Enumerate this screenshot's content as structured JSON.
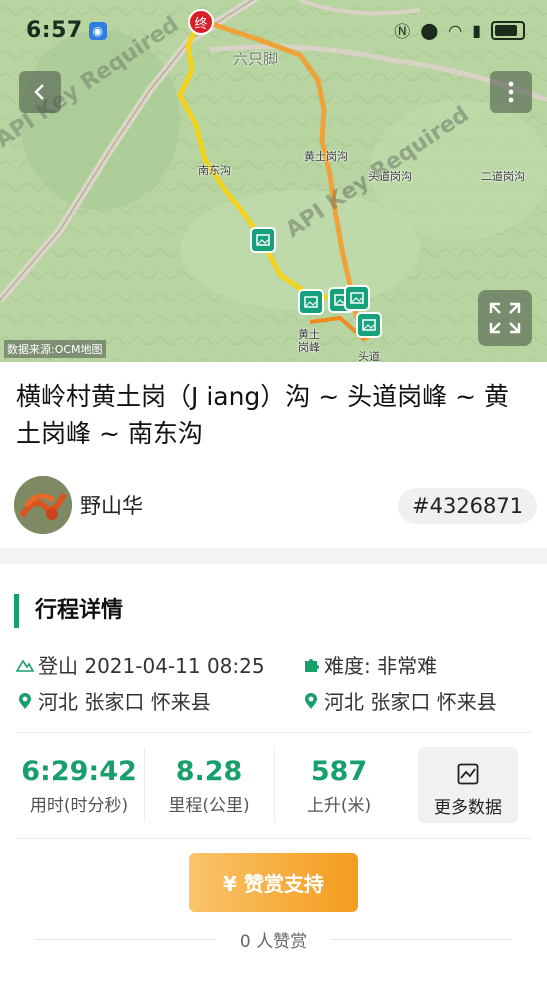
{
  "status_bar": {
    "time": "6:57",
    "icons": [
      "nfc-icon",
      "location-icon",
      "wifi-icon",
      "signal-icon",
      "battery-icon"
    ]
  },
  "map": {
    "end_marker_label": "终",
    "watermark": "API Key Required",
    "brand_watermark": "六只脚",
    "source": "数据来源:OCM地图",
    "places": [
      "黄土岗沟",
      "头道岗沟",
      "二道岗沟",
      "南东沟",
      "黄土岗峰",
      "头道"
    ],
    "route_colors": [
      "#f2d21b",
      "#f0a23a",
      "#e8751a"
    ]
  },
  "trip": {
    "title": "横岭村黄土岗（J iang）沟 ~ 头道岗峰 ~ 黄土岗峰 ~ 南东沟",
    "author": "野山华",
    "track_id": "#4326871"
  },
  "details": {
    "section_title": "行程详情",
    "activity": "登山 2021-04-11 08:25",
    "difficulty": "难度: 非常难",
    "start_location": "河北 张家口 怀来县",
    "end_location": "河北 张家口 怀来县",
    "stats": [
      {
        "value": "6:29:42",
        "label": "用时(时分秒)"
      },
      {
        "value": "8.28",
        "label": "里程(公里)"
      },
      {
        "value": "587",
        "label": "上升(米)"
      }
    ],
    "more_data_label": "更多数据"
  },
  "reward": {
    "button_label": "¥ 赞赏支持",
    "count_text": "0 人赞赏"
  },
  "accent_color": "#18a06c"
}
